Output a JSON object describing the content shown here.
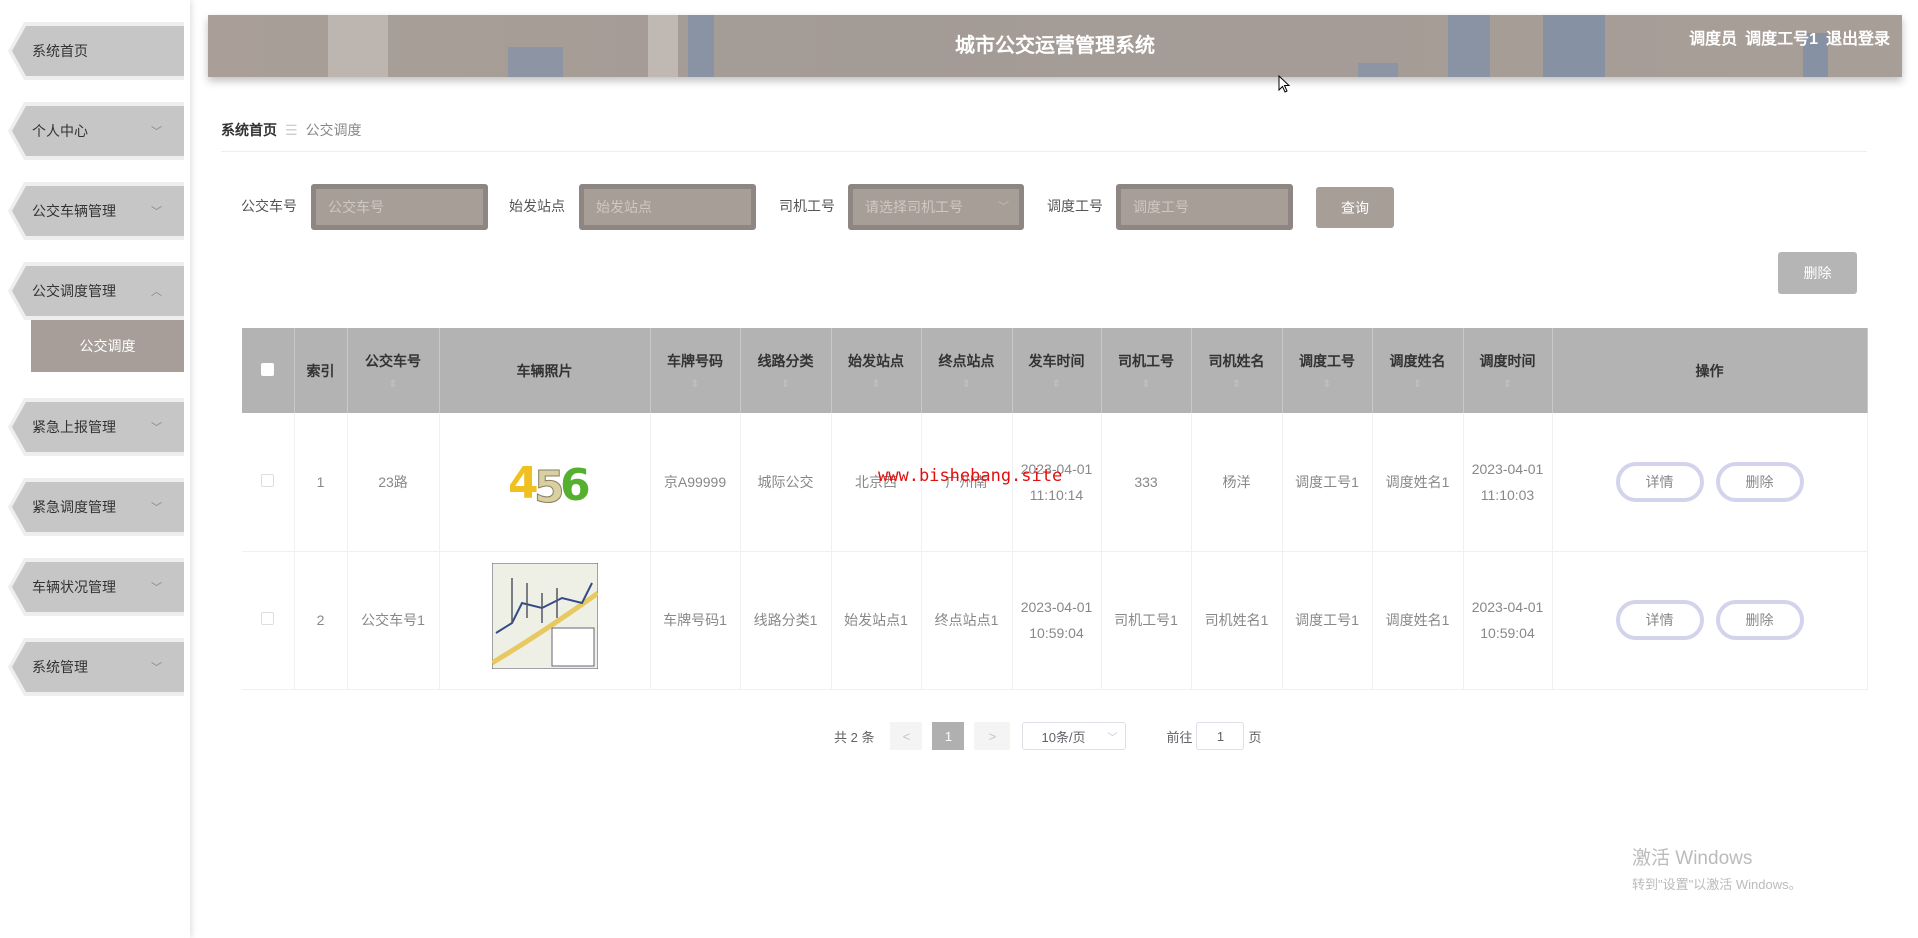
{
  "header": {
    "title": "城市公交运营管理系统",
    "role": "调度员",
    "username": "调度工号1",
    "logout": "退出登录"
  },
  "sidebar": {
    "items": [
      {
        "label": "系统首页",
        "chevron": ""
      },
      {
        "label": "个人中心",
        "chevron": "﹀"
      },
      {
        "label": "公交车辆管理",
        "chevron": "﹀"
      },
      {
        "label": "公交调度管理",
        "chevron": "︿"
      },
      {
        "label": "紧急上报管理",
        "chevron": "﹀"
      },
      {
        "label": "紧急调度管理",
        "chevron": "﹀"
      },
      {
        "label": "车辆状况管理",
        "chevron": "﹀"
      },
      {
        "label": "系统管理",
        "chevron": "﹀"
      }
    ],
    "sub_item": "公交调度"
  },
  "breadcrumb": {
    "home": "系统首页",
    "sep": "☰",
    "current": "公交调度"
  },
  "search": {
    "bus_label": "公交车号",
    "bus_placeholder": "公交车号",
    "start_label": "始发站点",
    "start_placeholder": "始发站点",
    "driver_label": "司机工号",
    "driver_placeholder": "请选择司机工号",
    "dispatch_label": "调度工号",
    "dispatch_placeholder": "调度工号",
    "query": "查询"
  },
  "toolbar": {
    "delete": "删除"
  },
  "table": {
    "headers": [
      "索引",
      "公交车号",
      "车辆照片",
      "车牌号码",
      "线路分类",
      "始发站点",
      "终点站点",
      "发车时间",
      "司机工号",
      "司机姓名",
      "调度工号",
      "调度姓名",
      "调度时间",
      "操作"
    ],
    "sort_icon": "⇕",
    "rows": [
      {
        "index": "1",
        "bus": "23路",
        "photo": "456",
        "plate": "京A99999",
        "route": "城际公交",
        "start": "北京西",
        "end": "广州南",
        "depart": "2023-04-01 11:10:14",
        "driver_id": "333",
        "driver_name": "杨洋",
        "dispatch_id": "调度工号1",
        "dispatch_name": "调度姓名1",
        "dispatch_time": "2023-04-01 11:10:03"
      },
      {
        "index": "2",
        "bus": "公交车号1",
        "photo": "map",
        "plate": "车牌号码1",
        "route": "线路分类1",
        "start": "始发站点1",
        "end": "终点站点1",
        "depart": "2023-04-01 10:59:04",
        "driver_id": "司机工号1",
        "driver_name": "司机姓名1",
        "dispatch_id": "调度工号1",
        "dispatch_name": "调度姓名1",
        "dispatch_time": "2023-04-01 10:59:04"
      }
    ],
    "detail": "详情",
    "delete": "删除"
  },
  "pagination": {
    "total": "共 2 条",
    "prev": "<",
    "page": "1",
    "next": ">",
    "size": "10条/页",
    "goto": "前往",
    "goto_value": "1",
    "page_unit": "页"
  },
  "watermark": "www.bishebang.site",
  "windows": {
    "line1": "激活 Windows",
    "line2": "转到\"设置\"以激活 Windows。"
  },
  "colors": {
    "accent": "#a89e98",
    "table_header": "#b3b3b3",
    "sidebar": "#c6c6c6"
  }
}
